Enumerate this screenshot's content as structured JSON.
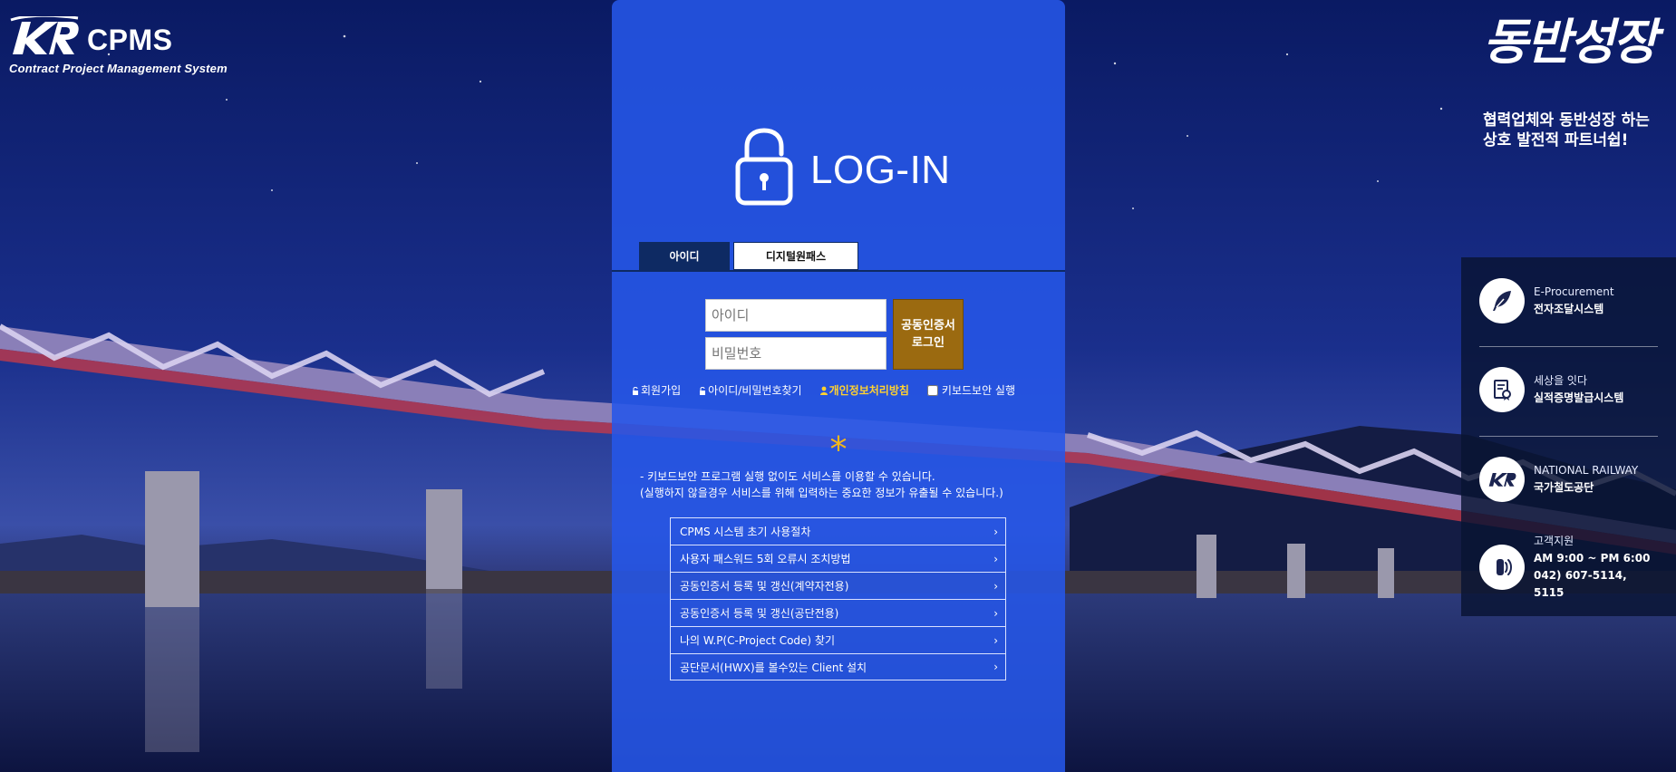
{
  "header": {
    "logo_name": "CPMS",
    "logo_subtitle": "Contract Project Management System"
  },
  "brand": {
    "title": "동반성장",
    "subtitle_line1": "협력업체와 동반성장 하는",
    "subtitle_line2": "상호 발전적 파트너쉽!"
  },
  "login": {
    "title": "LOG-IN",
    "tabs": [
      {
        "label": "아이디",
        "active": true
      },
      {
        "label": "디지털원패스",
        "active": false
      }
    ],
    "id_placeholder": "아이디",
    "pw_placeholder": "비밀번호",
    "cert_button_line1": "공동인증서",
    "cert_button_line2": "로그인",
    "links": {
      "signup": "회원가입",
      "find": "아이디/비밀번호찾기",
      "privacy": "개인정보처리방침",
      "keyboard": "키보드보안 실행"
    },
    "notice_line1": "- 키보드보안 프로그램 실행 없이도 서비스를 이용할 수 있습니다.",
    "notice_line2": "(실행하지 않을경우 서비스를 위해 입력하는 중요한 정보가 유출될 수 있습니다.)",
    "star": "*"
  },
  "menu": [
    {
      "label": "CPMS 시스템 초기 사용절차"
    },
    {
      "label": "사용자 패스워드 5회 오류시 조치방법"
    },
    {
      "label": "공동인증서 등록 및 갱신(계약자전용)"
    },
    {
      "label": "공동인증서 등록 및 갱신(공단전용)"
    },
    {
      "label": "나의 W.P(C-Project Code) 찾기"
    },
    {
      "label": "공단문서(HWX)를 볼수있는 Client 설치"
    }
  ],
  "side": {
    "items": [
      {
        "top": "E-Procurement",
        "bottom": "전자조달시스템",
        "icon": "quill-icon"
      },
      {
        "top": "세상을 잇다",
        "bottom": "실적증명발급시스템",
        "icon": "certificate-icon"
      },
      {
        "top": "NATIONAL RAILWAY",
        "bottom": "국가철도공단",
        "icon": "kr-logo-icon"
      }
    ],
    "support": {
      "label": "고객지원",
      "hours": "AM 9:00 ~ PM 6:00",
      "phone": "042) 607-5114, 5115"
    }
  },
  "colors": {
    "panel": "#2656e8",
    "tab_active": "#0e2a63",
    "cert_button": "#9b6a10",
    "privacy_link": "#ffd230",
    "star": "#f4b81a"
  }
}
